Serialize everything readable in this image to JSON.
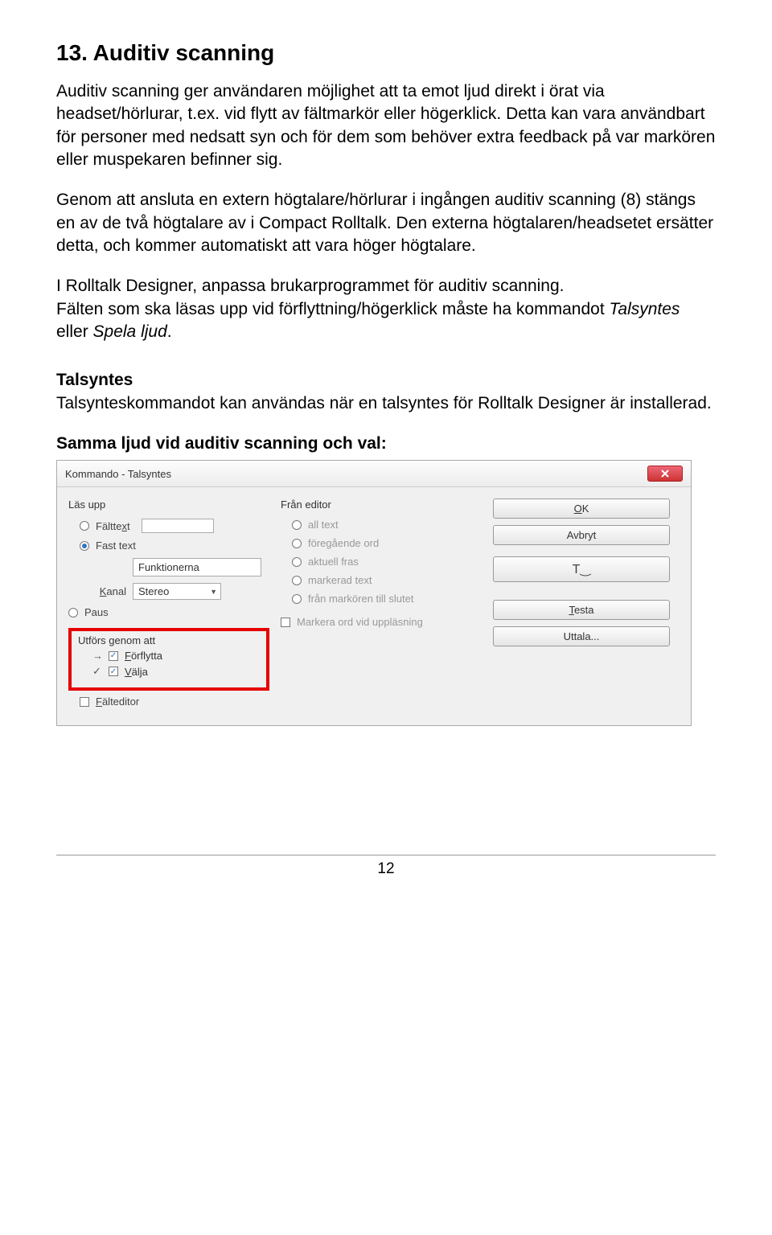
{
  "heading": "13.  Auditiv scanning",
  "p1": "Auditiv scanning ger användaren möjlighet att ta emot ljud direkt i örat via headset/hörlurar, t.ex. vid flytt av fältmarkör eller högerklick. Detta kan vara användbart för personer med nedsatt syn och för dem som behöver extra feedback på var markören eller muspekaren befinner sig.",
  "p2": "Genom att ansluta en extern högtalare/hörlurar i ingången auditiv scanning (8) stängs en av de två högtalare av i Compact Rolltalk. Den externa högtalaren/headsetet ersätter detta, och kommer automatiskt att vara höger högtalare.",
  "p3a": "I Rolltalk Designer, anpassa brukarprogrammet för auditiv scanning.",
  "p3b_pre": "Fälten som ska läsas upp vid förflyttning/högerklick måste ha kommandot ",
  "p3b_i1": "Talsyntes",
  "p3b_mid": " eller ",
  "p3b_i2": "Spela ljud",
  "p3b_end": ".",
  "talsyntes_h": "Talsyntes",
  "talsyntes_p": "Talsynteskommandot kan användas när en talsyntes för Rolltalk Designer är installerad.",
  "samma_h": "Samma ljud vid auditiv scanning och val:",
  "dialog": {
    "title": "Kommando - Talsyntes",
    "left": {
      "group": "Läs upp",
      "opt1_pre": "Fältte",
      "opt1_ul": "x",
      "opt1_post": "t",
      "opt2": "Fast text",
      "inputValue": "Funktionerna",
      "kanal_pre": "",
      "kanal_ul": "K",
      "kanal_post": "anal",
      "kanalValue": "Stereo",
      "paus": "Paus"
    },
    "mid": {
      "group": "Från editor",
      "o1": "all text",
      "o2": "föregående ord",
      "o3": "aktuell fras",
      "o4": "markerad text",
      "o5": "från markören till slutet",
      "chk": "Markera ord vid uppläsning"
    },
    "right": {
      "ok_ul": "O",
      "ok_post": "K",
      "avbryt": "Avbryt",
      "testa_ul": "T",
      "testa_post": "esta",
      "uttala": "Uttala..."
    },
    "utfors": {
      "title": "Utförs genom att",
      "f_ul": "F",
      "f_post": "örflytta",
      "v_ul": "V",
      "v_post": "älja"
    },
    "falteditor_ul": "F",
    "falteditor_post": "älteditor"
  },
  "pageNum": "12"
}
